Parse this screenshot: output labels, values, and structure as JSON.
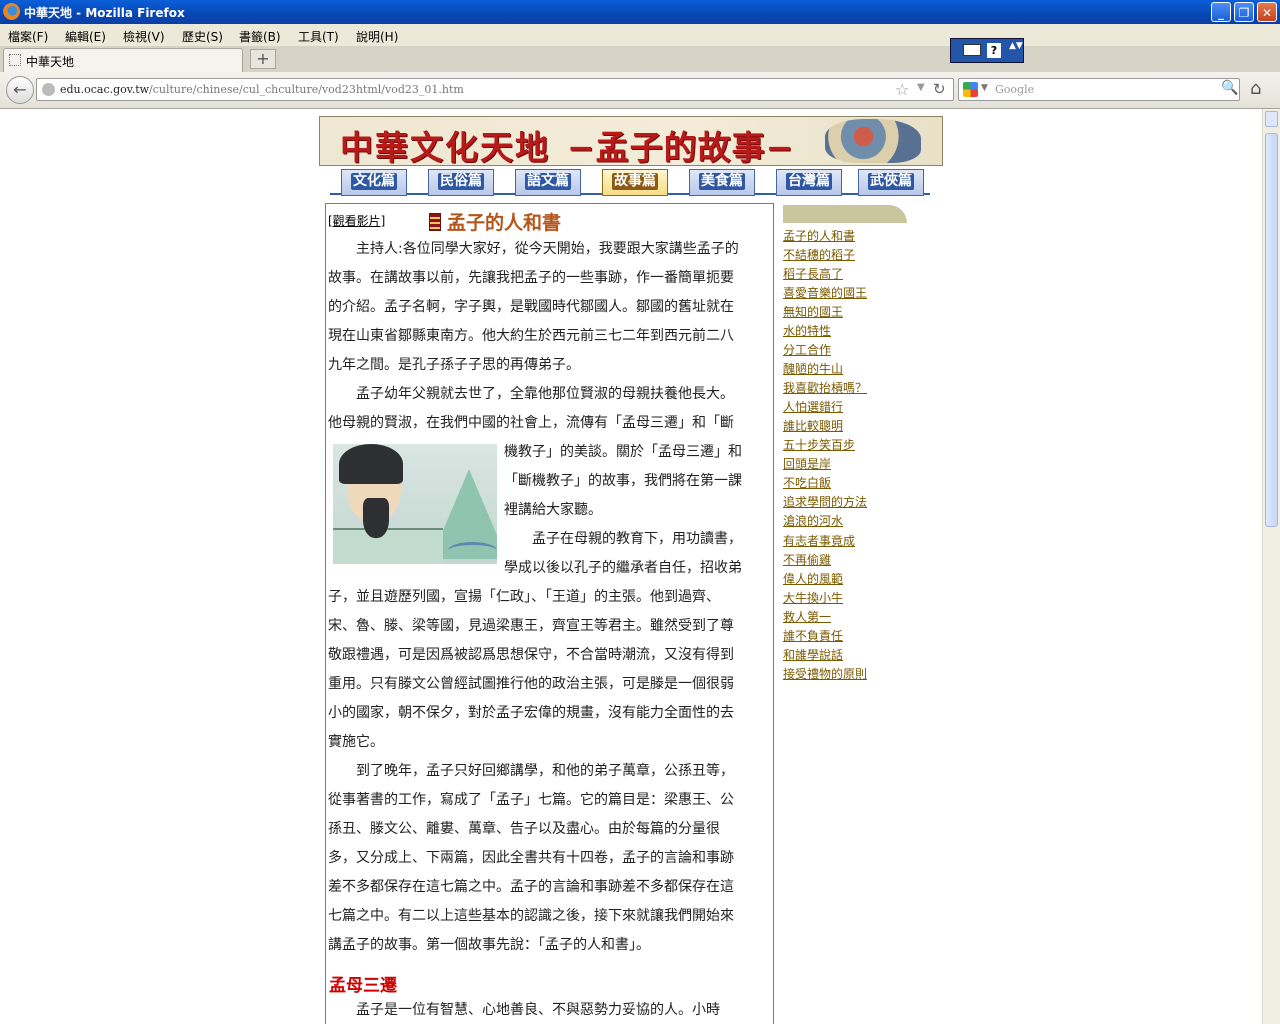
{
  "window": {
    "title": "中華天地 - Mozilla Firefox",
    "minimize": "_",
    "maximize": "❐",
    "close": "✕"
  },
  "menu": [
    "檔案(F)",
    "編輯(E)",
    "檢視(V)",
    "歷史(S)",
    "書籤(B)",
    "工具(T)",
    "說明(H)"
  ],
  "tab": {
    "label": "中華天地",
    "new_tab": "+"
  },
  "ime": {
    "help": "?",
    "arrows": "▲▼"
  },
  "address": {
    "domain": "edu.ocac.gov.tw",
    "path": "/culture/chinese/cul_chculture/vod23html/vod23_01.htm"
  },
  "search": {
    "placeholder": "Google"
  },
  "icons": {
    "back": "←",
    "star": "☆",
    "dropdown": "▼",
    "reload": "↻",
    "magnifier": "🔍",
    "home": "⌂"
  },
  "banner": {
    "site": "中華文化天地",
    "topic": "−孟子的故事−"
  },
  "nav": [
    "文化篇",
    "民俗篇",
    "語文篇",
    "故事篇",
    "美食篇",
    "台灣篇",
    "武俠篇"
  ],
  "nav_active": "故事篇",
  "content": {
    "video_link": "[觀看影片]",
    "lesson_title": "孟子的人和書",
    "para1": [
      "　　主持人:各位同學大家好，從今天開始，我要跟大家講些孟子的",
      "故事。在講故事以前，先讓我把孟子的一些事跡，作一番簡單扼要",
      "的介紹。孟子名軻，字子輿，是戰國時代鄒國人。鄒國的舊址就在",
      "現在山東省鄒縣東南方。他大約生於西元前三七二年到西元前二八",
      "九年之間。是孔子孫子子思的再傳弟子。"
    ],
    "para2_full": [
      "　　孟子幼年父親就去世了，全靠他那位賢淑的母親扶養他長大。",
      "他母親的賢淑，在我們中國的社會上，流傳有「孟母三遷」和「斷"
    ],
    "para2_wrap": [
      "機教子」的美談。關於「孟母三遷」和",
      "「斷機教子」的故事，我們將在第一課",
      "裡講給大家聽。",
      "　　孟子在母親的教育下，用功讀書，",
      "學成以後以孔子的繼承者自任，招收弟"
    ],
    "para3": [
      "子，並且遊歷列國，宣揚「仁政」、「王道」的主張。他到過齊、",
      "宋、魯、滕、梁等國，見過梁惠王，齊宣王等君主。雖然受到了尊",
      "敬跟禮遇，可是因爲被認爲思想保守，不合當時潮流，又沒有得到",
      "重用。只有滕文公曾經試圖推行他的政治主張，可是滕是一個很弱",
      "小的國家，朝不保夕，對於孟子宏偉的規畫，沒有能力全面性的去",
      "實施它。",
      "　　到了晚年，孟子只好回鄉講學，和他的弟子萬章，公孫丑等，",
      "從事著書的工作，寫成了「孟子」七篇。它的篇目是：梁惠王、公",
      "孫丑、滕文公、離婁、萬章、告子以及盡心。由於每篇的分量很",
      "多，又分成上、下兩篇，因此全書共有十四卷，孟子的言論和事跡",
      "差不多都保存在這七篇之中。孟子的言論和事跡差不多都保存在這",
      "七篇之中。有二以上這些基本的認識之後，接下來就讓我們開始來",
      "講孟子的故事。第一個故事先說：「孟子的人和書」。"
    ],
    "subhead": "孟母三遷",
    "para4": [
      "　　孟子是一位有智慧、心地善良、不與惡勢力妥協的人。小時"
    ]
  },
  "sidebar_links": [
    "孟子的人和書",
    "不結穗的稻子",
    "稻子長高了",
    "喜愛音樂的國王",
    "無知的國王",
    "水的特性",
    "分工合作",
    "醜陋的牛山",
    "我喜歡抬槓嗎？",
    "人怕選錯行",
    "誰比較聰明",
    "五十步笑百步",
    "回頭是岸",
    "不吃白飯",
    "追求學問的方法",
    "滄浪的河水",
    "有志者事竟成",
    "不再偷雞",
    "偉人的風範",
    "大牛換小牛",
    "救人第一",
    "誰不負責任",
    "和誰學說話",
    "接受禮物的原則"
  ]
}
